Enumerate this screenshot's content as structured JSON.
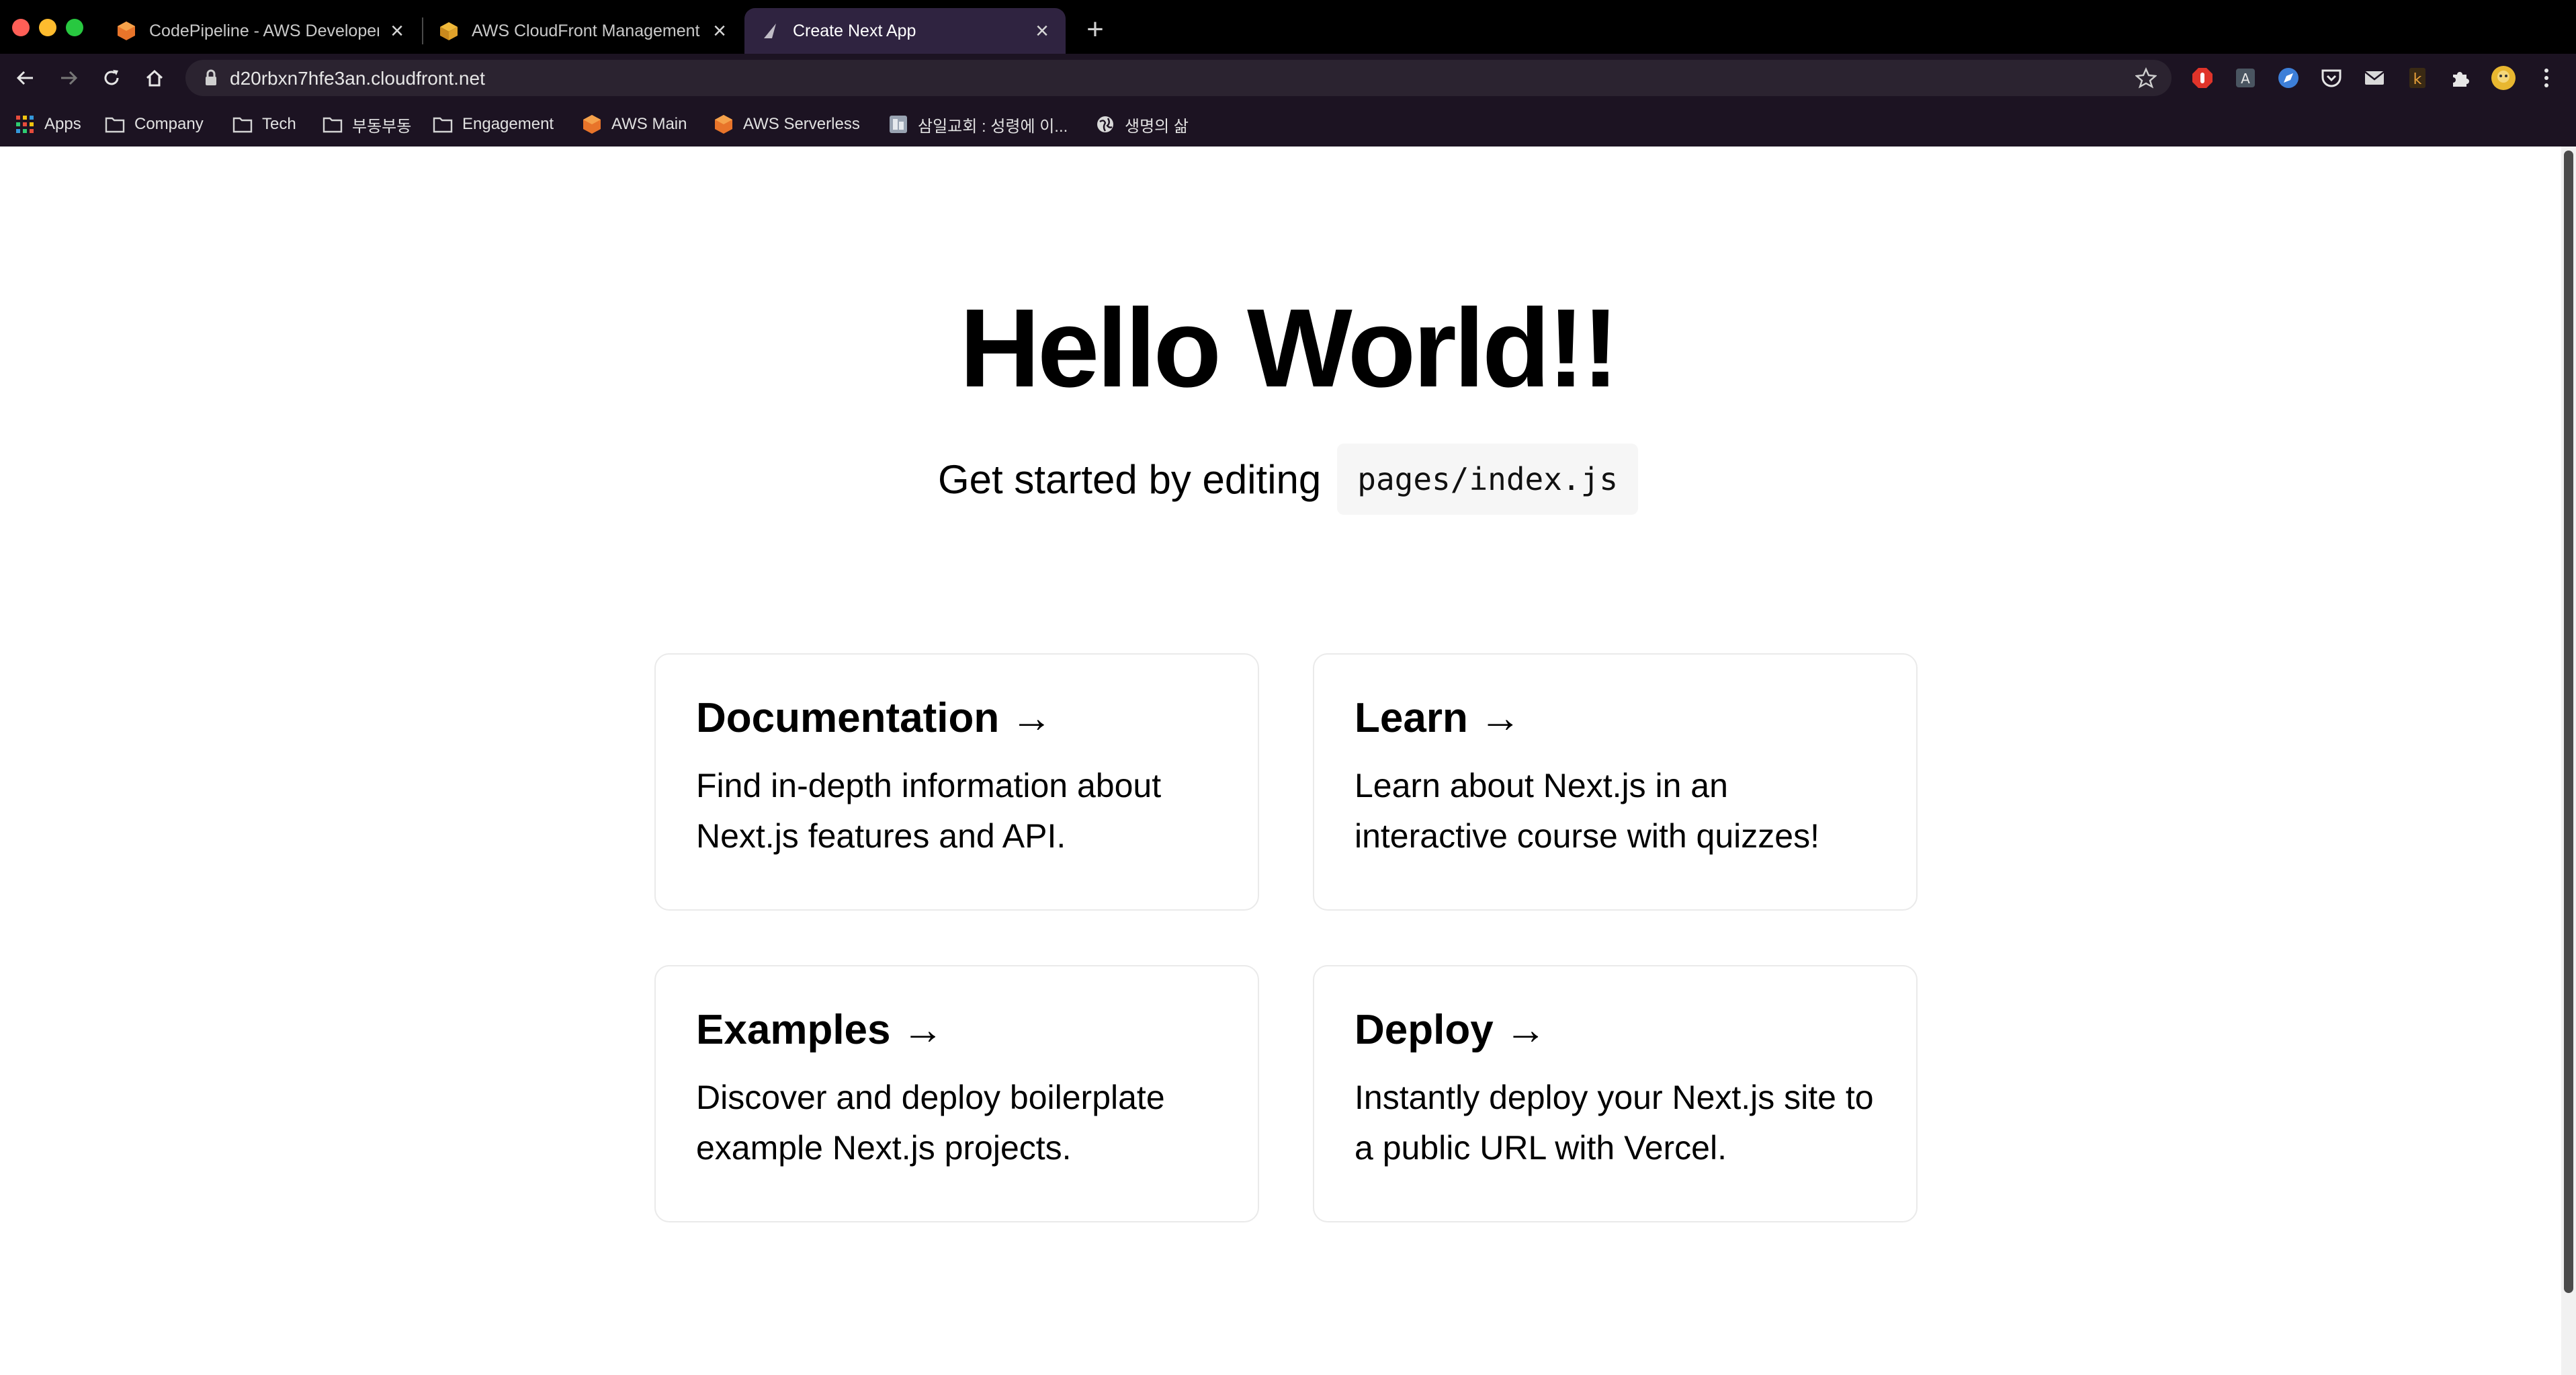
{
  "browser": {
    "tabs": [
      {
        "title": "CodePipeline - AWS Developer",
        "icon": "aws-codepipeline-icon",
        "active": false
      },
      {
        "title": "AWS CloudFront Management",
        "icon": "aws-cloudfront-icon",
        "active": false
      },
      {
        "title": "Create Next App",
        "icon": "nextjs-icon",
        "active": true
      }
    ],
    "url": "d20rbxn7hfe3an.cloudfront.net",
    "bookmarks": [
      {
        "label": "Apps",
        "icon": "apps-grid-icon"
      },
      {
        "label": "Company",
        "icon": "folder-icon"
      },
      {
        "label": "Tech",
        "icon": "folder-icon"
      },
      {
        "label": "부동부동",
        "icon": "folder-icon"
      },
      {
        "label": "Engagement",
        "icon": "folder-icon"
      },
      {
        "label": "AWS Main",
        "icon": "aws-icon"
      },
      {
        "label": "AWS Serverless",
        "icon": "aws-icon"
      },
      {
        "label": "삼일교회 : 성령에 이...",
        "icon": "site-icon"
      },
      {
        "label": "생명의 삶",
        "icon": "globe-icon"
      }
    ],
    "colors": {
      "tab_active": "#2f2340",
      "toolbar": "#1c1322"
    }
  },
  "page": {
    "title": "Hello World!!",
    "subtitle": "Get started by editing",
    "code": "pages/index.js",
    "cards": [
      {
        "title": "Documentation →",
        "description": "Find in-depth information about Next.js features and API."
      },
      {
        "title": "Learn →",
        "description": "Learn about Next.js in an interactive course with quizzes!"
      },
      {
        "title": "Examples →",
        "description": "Discover and deploy boilerplate example Next.js projects."
      },
      {
        "title": "Deploy →",
        "description": "Instantly deploy your Next.js site to a public URL with Vercel."
      }
    ]
  }
}
